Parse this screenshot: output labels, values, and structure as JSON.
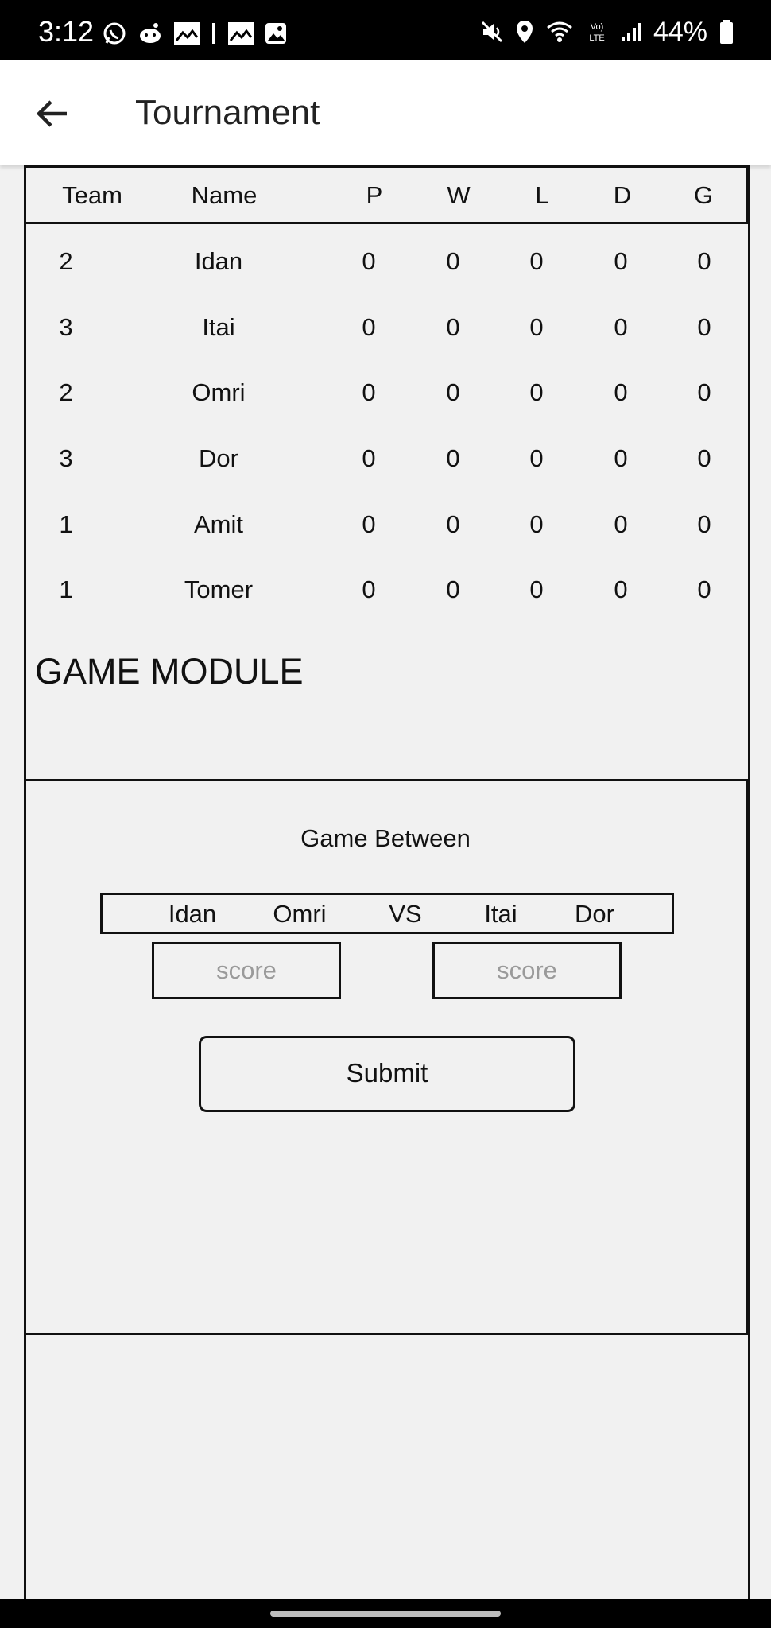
{
  "status_bar": {
    "time": "3:12",
    "battery": "44%",
    "left_icons": [
      "whatsapp-icon",
      "reddit-icon",
      "gallery-icon",
      "divider",
      "gallery-icon",
      "image-icon"
    ],
    "right_icons": [
      "mute-icon",
      "location-icon",
      "wifi-icon",
      "volte-icon",
      "signal-icon",
      "battery-icon"
    ]
  },
  "app_bar": {
    "title": "Tournament",
    "back_icon": "arrow-left-icon"
  },
  "standings": {
    "columns": [
      "Team",
      "Name",
      "P",
      "W",
      "L",
      "D",
      "G"
    ],
    "rows": [
      {
        "team": "2",
        "name": "Idan",
        "p": "0",
        "w": "0",
        "l": "0",
        "d": "0",
        "g": "0"
      },
      {
        "team": "3",
        "name": "Itai",
        "p": "0",
        "w": "0",
        "l": "0",
        "d": "0",
        "g": "0"
      },
      {
        "team": "2",
        "name": "Omri",
        "p": "0",
        "w": "0",
        "l": "0",
        "d": "0",
        "g": "0"
      },
      {
        "team": "3",
        "name": "Dor",
        "p": "0",
        "w": "0",
        "l": "0",
        "d": "0",
        "g": "0"
      },
      {
        "team": "1",
        "name": "Amit",
        "p": "0",
        "w": "0",
        "l": "0",
        "d": "0",
        "g": "0"
      },
      {
        "team": "1",
        "name": "Tomer",
        "p": "0",
        "w": "0",
        "l": "0",
        "d": "0",
        "g": "0"
      }
    ]
  },
  "game_module": {
    "title": "GAME MODULE",
    "game_between": "Game Between",
    "match": {
      "team_a_player1": "Idan",
      "team_a_player2": "Omri",
      "vs": "VS",
      "team_b_player1": "Itai",
      "team_b_player2": "Dor"
    },
    "score_left_placeholder": "score",
    "score_right_placeholder": "score",
    "submit_label": "Submit"
  }
}
